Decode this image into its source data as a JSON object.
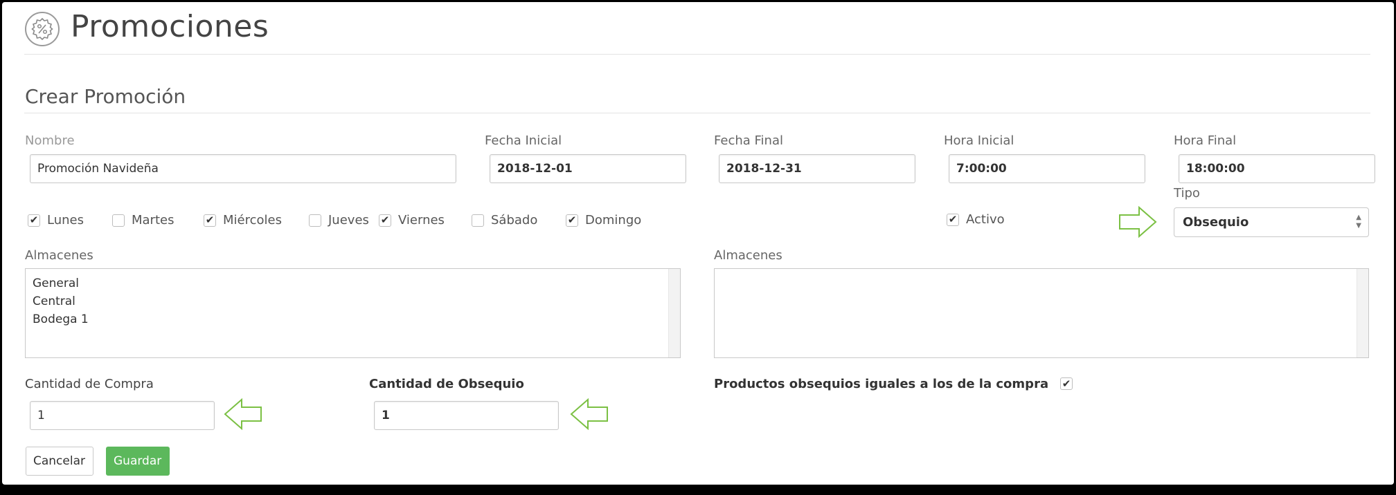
{
  "header": {
    "title": "Promociones",
    "icon": "percent-badge-icon"
  },
  "form": {
    "section_title": "Crear Promoción",
    "nombre": {
      "label": "Nombre",
      "value": "Promoción Navideña"
    },
    "fecha_inicial": {
      "label": "Fecha Inicial",
      "value": "2018-12-01"
    },
    "fecha_final": {
      "label": "Fecha Final",
      "value": "2018-12-31"
    },
    "hora_inicial": {
      "label": "Hora Inicial",
      "value": "7:00:00"
    },
    "hora_final": {
      "label": "Hora Final",
      "value": "18:00:00"
    },
    "tipo": {
      "label": "Tipo",
      "value": "Obsequio"
    },
    "days": [
      {
        "label": "Lunes",
        "checked": true
      },
      {
        "label": "Martes",
        "checked": false
      },
      {
        "label": "Miércoles",
        "checked": true
      },
      {
        "label": "Jueves",
        "checked": false
      },
      {
        "label": "Viernes",
        "checked": true
      },
      {
        "label": "Sábado",
        "checked": false
      },
      {
        "label": "Domingo",
        "checked": true
      }
    ],
    "activo": {
      "label": "Activo",
      "checked": true
    },
    "almacenes_disponibles": {
      "label": "Almacenes",
      "options": [
        "General",
        "Central",
        "Bodega 1"
      ]
    },
    "almacenes_seleccionados": {
      "label": "Almacenes",
      "options": []
    },
    "cantidad_compra": {
      "label": "Cantidad de Compra",
      "value": "1"
    },
    "cantidad_obsequio": {
      "label": "Cantidad de Obsequio",
      "value": "1"
    },
    "productos_iguales": {
      "label": "Productos obsequios iguales a los de la compra",
      "checked": true
    }
  },
  "buttons": {
    "cancel": "Cancelar",
    "save": "Guardar"
  },
  "colors": {
    "accent_green": "#5cb85c",
    "arrow_green": "#7bc043"
  }
}
